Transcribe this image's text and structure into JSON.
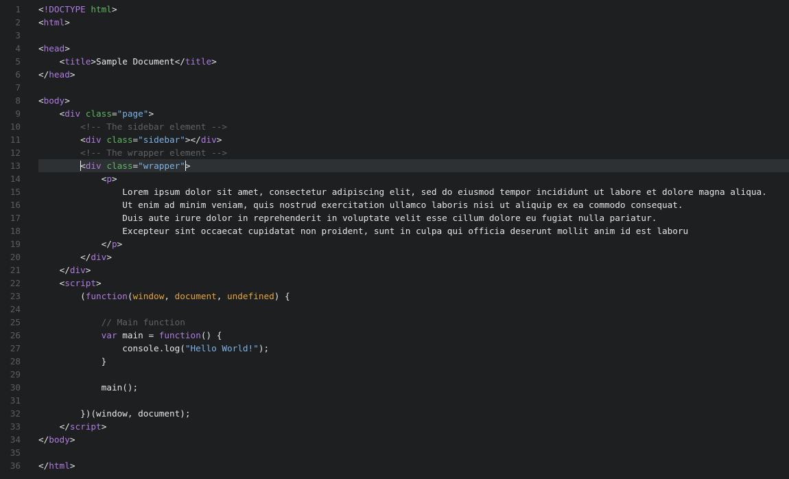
{
  "editor": {
    "active_line": 13,
    "colors": {
      "background": "#1d1f21",
      "active_line": "#2e3133",
      "line_number": "#5a5e63",
      "tag": "#b07be0",
      "attribute": "#5fb760",
      "string": "#7fb2e6",
      "comment": "#5f6368",
      "keyword": "#b07be0",
      "parameter": "#e6a43c",
      "text": "#e6e6e6"
    },
    "lines": [
      {
        "n": "1",
        "tokens": [
          [
            "t-punct",
            "<"
          ],
          [
            "t-tag",
            "!DOCTYPE"
          ],
          [
            "t-punct",
            " "
          ],
          [
            "t-attr",
            "html"
          ],
          [
            "t-punct",
            ">"
          ]
        ]
      },
      {
        "n": "2",
        "tokens": [
          [
            "t-punct",
            "<"
          ],
          [
            "t-tag",
            "html"
          ],
          [
            "t-punct",
            ">"
          ]
        ]
      },
      {
        "n": "3",
        "tokens": []
      },
      {
        "n": "4",
        "tokens": [
          [
            "t-punct",
            "<"
          ],
          [
            "t-tag",
            "head"
          ],
          [
            "t-punct",
            ">"
          ]
        ]
      },
      {
        "n": "5",
        "tokens": [
          [
            "t-text",
            "    "
          ],
          [
            "t-punct",
            "<"
          ],
          [
            "t-tag",
            "title"
          ],
          [
            "t-punct",
            ">"
          ],
          [
            "t-text",
            "Sample Document"
          ],
          [
            "t-punct",
            "</"
          ],
          [
            "t-tag",
            "title"
          ],
          [
            "t-punct",
            ">"
          ]
        ]
      },
      {
        "n": "6",
        "tokens": [
          [
            "t-punct",
            "</"
          ],
          [
            "t-tag",
            "head"
          ],
          [
            "t-punct",
            ">"
          ]
        ]
      },
      {
        "n": "7",
        "tokens": []
      },
      {
        "n": "8",
        "tokens": [
          [
            "t-punct",
            "<"
          ],
          [
            "t-tag",
            "body"
          ],
          [
            "t-punct",
            ">"
          ]
        ]
      },
      {
        "n": "9",
        "tokens": [
          [
            "t-text",
            "    "
          ],
          [
            "t-punct",
            "<"
          ],
          [
            "t-tag",
            "div"
          ],
          [
            "t-punct",
            " "
          ],
          [
            "t-attr",
            "class"
          ],
          [
            "t-punct",
            "="
          ],
          [
            "t-str",
            "\"page\""
          ],
          [
            "t-punct",
            ">"
          ]
        ]
      },
      {
        "n": "10",
        "tokens": [
          [
            "t-text",
            "        "
          ],
          [
            "t-com",
            "<!-- The sidebar element -->"
          ]
        ]
      },
      {
        "n": "11",
        "tokens": [
          [
            "t-text",
            "        "
          ],
          [
            "t-punct",
            "<"
          ],
          [
            "t-tag",
            "div"
          ],
          [
            "t-punct",
            " "
          ],
          [
            "t-attr",
            "class"
          ],
          [
            "t-punct",
            "="
          ],
          [
            "t-str",
            "\"sidebar\""
          ],
          [
            "t-punct",
            "></"
          ],
          [
            "t-tag",
            "div"
          ],
          [
            "t-punct",
            ">"
          ]
        ]
      },
      {
        "n": "12",
        "tokens": [
          [
            "t-text",
            "        "
          ],
          [
            "t-com",
            "<!-- The wrapper element -->"
          ]
        ]
      },
      {
        "n": "13",
        "tokens": [
          [
            "t-text",
            "        "
          ],
          [
            "caret",
            ""
          ],
          [
            "t-punct",
            "<"
          ],
          [
            "t-tag",
            "div"
          ],
          [
            "t-punct",
            " "
          ],
          [
            "t-attr",
            "class"
          ],
          [
            "t-punct",
            "="
          ],
          [
            "t-str",
            "\"wrapper\""
          ],
          [
            "caret",
            ""
          ],
          [
            "t-punct",
            ">"
          ]
        ]
      },
      {
        "n": "14",
        "tokens": [
          [
            "t-text",
            "            "
          ],
          [
            "t-punct",
            "<"
          ],
          [
            "t-tag",
            "p"
          ],
          [
            "t-punct",
            ">"
          ]
        ]
      },
      {
        "n": "15",
        "tokens": [
          [
            "t-text",
            "                Lorem ipsum dolor sit amet, consectetur adipiscing elit, sed do eiusmod tempor incididunt ut labore et dolore magna aliqua."
          ]
        ]
      },
      {
        "n": "16",
        "tokens": [
          [
            "t-text",
            "                Ut enim ad minim veniam, quis nostrud exercitation ullamco laboris nisi ut aliquip ex ea commodo consequat."
          ]
        ]
      },
      {
        "n": "17",
        "tokens": [
          [
            "t-text",
            "                Duis aute irure dolor in reprehenderit in voluptate velit esse cillum dolore eu fugiat nulla pariatur."
          ]
        ]
      },
      {
        "n": "18",
        "tokens": [
          [
            "t-text",
            "                Excepteur sint occaecat cupidatat non proident, sunt in culpa qui officia deserunt mollit anim id est laboru"
          ]
        ]
      },
      {
        "n": "19",
        "tokens": [
          [
            "t-text",
            "            "
          ],
          [
            "t-punct",
            "</"
          ],
          [
            "t-tag",
            "p"
          ],
          [
            "t-punct",
            ">"
          ]
        ]
      },
      {
        "n": "20",
        "tokens": [
          [
            "t-text",
            "        "
          ],
          [
            "t-punct",
            "</"
          ],
          [
            "t-tag",
            "div"
          ],
          [
            "t-punct",
            ">"
          ]
        ]
      },
      {
        "n": "21",
        "tokens": [
          [
            "t-text",
            "    "
          ],
          [
            "t-punct",
            "</"
          ],
          [
            "t-tag",
            "div"
          ],
          [
            "t-punct",
            ">"
          ]
        ]
      },
      {
        "n": "22",
        "tokens": [
          [
            "t-text",
            "    "
          ],
          [
            "t-punct",
            "<"
          ],
          [
            "t-tag",
            "script"
          ],
          [
            "t-punct",
            ">"
          ]
        ]
      },
      {
        "n": "23",
        "tokens": [
          [
            "t-text",
            "        "
          ],
          [
            "t-punct",
            "("
          ],
          [
            "t-kw",
            "function"
          ],
          [
            "t-punct",
            "("
          ],
          [
            "t-param",
            "window"
          ],
          [
            "t-punct",
            ", "
          ],
          [
            "t-param",
            "document"
          ],
          [
            "t-punct",
            ", "
          ],
          [
            "t-param",
            "undefined"
          ],
          [
            "t-punct",
            ") {"
          ]
        ]
      },
      {
        "n": "24",
        "tokens": []
      },
      {
        "n": "25",
        "tokens": [
          [
            "t-text",
            "            "
          ],
          [
            "t-com",
            "// Main function"
          ]
        ]
      },
      {
        "n": "26",
        "tokens": [
          [
            "t-text",
            "            "
          ],
          [
            "t-kw",
            "var"
          ],
          [
            "t-id",
            " main "
          ],
          [
            "t-punct",
            "= "
          ],
          [
            "t-kw",
            "function"
          ],
          [
            "t-punct",
            "() {"
          ]
        ]
      },
      {
        "n": "27",
        "tokens": [
          [
            "t-text",
            "                "
          ],
          [
            "t-id",
            "console.log"
          ],
          [
            "t-punct",
            "("
          ],
          [
            "t-str",
            "\"Hello World!\""
          ],
          [
            "t-punct",
            ");"
          ]
        ]
      },
      {
        "n": "28",
        "tokens": [
          [
            "t-text",
            "            "
          ],
          [
            "t-punct",
            "}"
          ]
        ]
      },
      {
        "n": "29",
        "tokens": []
      },
      {
        "n": "30",
        "tokens": [
          [
            "t-text",
            "            "
          ],
          [
            "t-id",
            "main"
          ],
          [
            "t-punct",
            "();"
          ]
        ]
      },
      {
        "n": "31",
        "tokens": []
      },
      {
        "n": "32",
        "tokens": [
          [
            "t-text",
            "        "
          ],
          [
            "t-punct",
            "})("
          ],
          [
            "t-id",
            "window"
          ],
          [
            "t-punct",
            ", "
          ],
          [
            "t-id",
            "document"
          ],
          [
            "t-punct",
            ");"
          ]
        ]
      },
      {
        "n": "33",
        "tokens": [
          [
            "t-text",
            "    "
          ],
          [
            "t-punct",
            "</"
          ],
          [
            "t-tag",
            "script"
          ],
          [
            "t-punct",
            ">"
          ]
        ]
      },
      {
        "n": "34",
        "tokens": [
          [
            "t-punct",
            "</"
          ],
          [
            "t-tag",
            "body"
          ],
          [
            "t-punct",
            ">"
          ]
        ]
      },
      {
        "n": "35",
        "tokens": []
      },
      {
        "n": "36",
        "tokens": [
          [
            "t-punct",
            "</"
          ],
          [
            "t-tag",
            "html"
          ],
          [
            "t-punct",
            ">"
          ]
        ]
      }
    ]
  }
}
